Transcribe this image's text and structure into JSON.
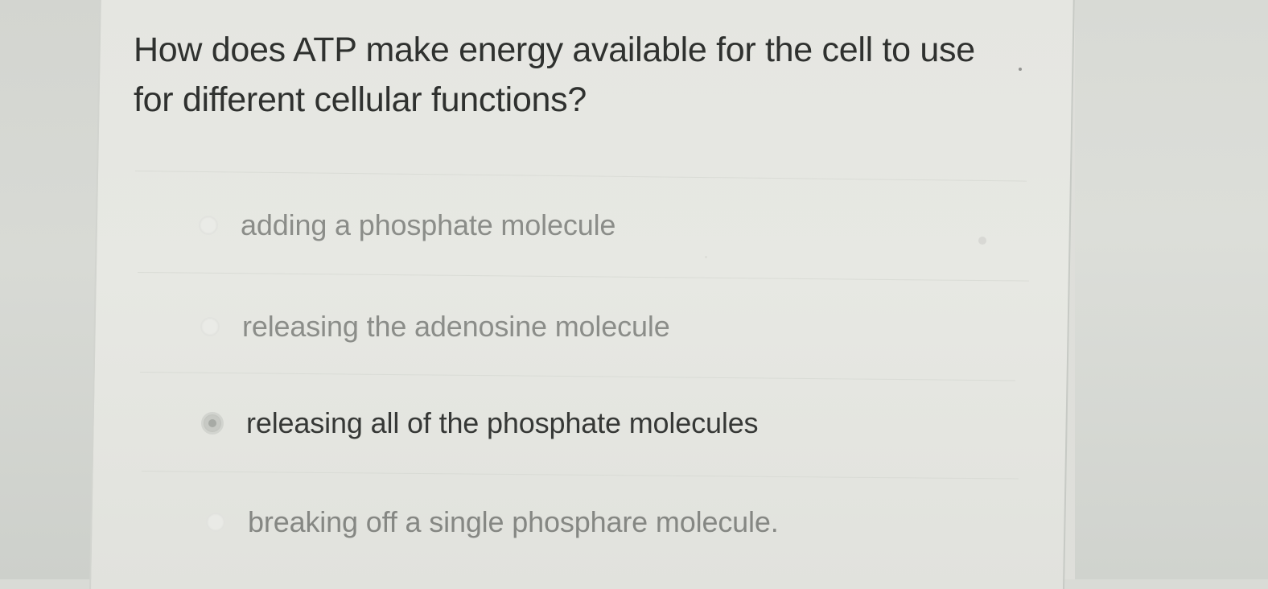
{
  "question": {
    "text": "How does ATP make energy available for the cell to use for different cellular functions?"
  },
  "answers": [
    {
      "label": "adding a phosphate molecule",
      "selected": false
    },
    {
      "label": "releasing the adenosine molecule",
      "selected": false
    },
    {
      "label": "releasing all of the phosphate molecules",
      "selected": true
    },
    {
      "label": "breaking off a single phosphare molecule.",
      "selected": false
    }
  ],
  "colors": {
    "question_text": "#2f312f",
    "selected_answer_text": "#363836",
    "unselected_answer_text": "#8b8d89",
    "card_background": "#e5e6e1"
  }
}
